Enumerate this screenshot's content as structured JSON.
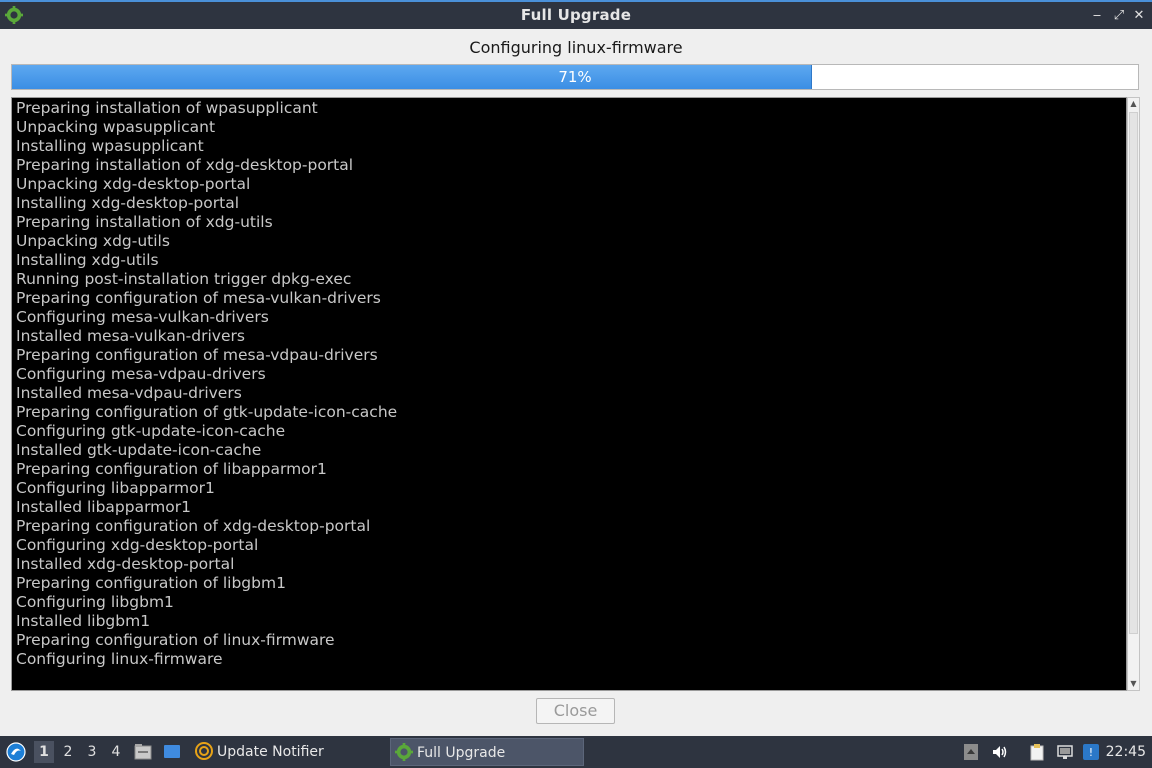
{
  "window": {
    "title": "Full Upgrade",
    "controls": {
      "minimize": "‒",
      "maximize": "⤢",
      "close": "✕"
    }
  },
  "status": {
    "message": "Configuring linux-firmware"
  },
  "progress": {
    "percent": 71,
    "label": "71%",
    "color": "#4a9be8"
  },
  "log": {
    "lines": [
      "Preparing installation of wpasupplicant",
      "Unpacking wpasupplicant",
      "Installing wpasupplicant",
      "Preparing installation of xdg-desktop-portal",
      "Unpacking xdg-desktop-portal",
      "Installing xdg-desktop-portal",
      "Preparing installation of xdg-utils",
      "Unpacking xdg-utils",
      "Installing xdg-utils",
      "Running post-installation trigger dpkg-exec",
      "Preparing configuration of mesa-vulkan-drivers",
      "Configuring mesa-vulkan-drivers",
      "Installed mesa-vulkan-drivers",
      "Preparing configuration of mesa-vdpau-drivers",
      "Configuring mesa-vdpau-drivers",
      "Installed mesa-vdpau-drivers",
      "Preparing configuration of gtk-update-icon-cache",
      "Configuring gtk-update-icon-cache",
      "Installed gtk-update-icon-cache",
      "Preparing configuration of libapparmor1",
      "Configuring libapparmor1",
      "Installed libapparmor1",
      "Preparing configuration of xdg-desktop-portal",
      "Configuring xdg-desktop-portal",
      "Installed xdg-desktop-portal",
      "Preparing configuration of libgbm1",
      "Configuring libgbm1",
      "Installed libgbm1",
      "Preparing configuration of linux-firmware",
      "Configuring linux-firmware"
    ]
  },
  "buttons": {
    "close": "Close"
  },
  "taskbar": {
    "start_icon": "lubuntu-logo-icon",
    "desktops": [
      "1",
      "2",
      "3",
      "4"
    ],
    "active_desktop": "1",
    "tasks": [
      {
        "label": "Update Notifier",
        "icon": "update-notifier-icon",
        "active": false
      },
      {
        "label": "Full Upgrade",
        "icon": "gear-icon",
        "active": true
      }
    ],
    "tray_icons": [
      "tray-arrow-icon",
      "volume-icon",
      "clipboard-icon",
      "network-icon",
      "notification-icon"
    ],
    "clock": "22:45"
  }
}
